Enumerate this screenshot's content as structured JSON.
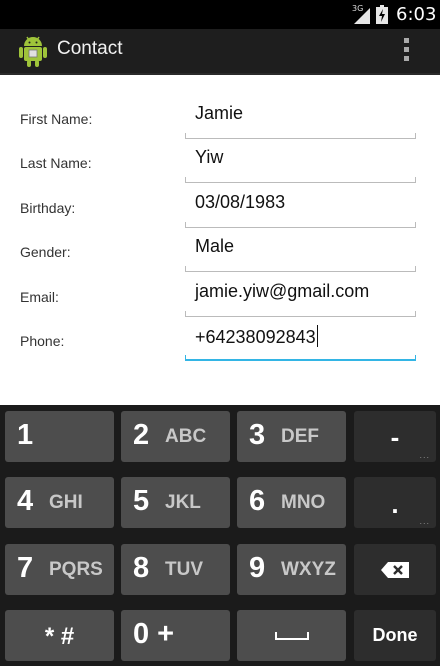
{
  "status_bar": {
    "network": "3G",
    "time": "6:03"
  },
  "action_bar": {
    "title": "Contact",
    "icon": "android-robot-icon",
    "overflow_icon": "overflow-menu-icon"
  },
  "form": {
    "fields": [
      {
        "label": "First Name:",
        "value": "Jamie"
      },
      {
        "label": "Last Name:",
        "value": "Yiw"
      },
      {
        "label": "Birthday:",
        "value": "03/08/1983"
      },
      {
        "label": "Gender:",
        "value": "Male"
      },
      {
        "label": "Email:",
        "value": "jamie.yiw@gmail.com"
      },
      {
        "label": "Phone:",
        "value": "+64238092843"
      }
    ],
    "focused_field": "Phone:",
    "focus_color": "#33b5e5"
  },
  "keyboard": {
    "keys": [
      {
        "main": "1",
        "sub": ""
      },
      {
        "main": "2",
        "sub": "ABC"
      },
      {
        "main": "3",
        "sub": "DEF"
      },
      {
        "main": "-",
        "sub": ""
      },
      {
        "main": "4",
        "sub": "GHI"
      },
      {
        "main": "5",
        "sub": "JKL"
      },
      {
        "main": "6",
        "sub": "MNO"
      },
      {
        "main": ".",
        "sub": ""
      },
      {
        "main": "7",
        "sub": "PQRS"
      },
      {
        "main": "8",
        "sub": "TUV"
      },
      {
        "main": "9",
        "sub": "WXYZ"
      },
      {
        "main": "backspace-icon",
        "sub": ""
      },
      {
        "main": "* #",
        "sub": ""
      },
      {
        "main": "0 +",
        "sub": ""
      },
      {
        "main": "space-icon",
        "sub": ""
      },
      {
        "main": "Done",
        "sub": ""
      }
    ]
  }
}
